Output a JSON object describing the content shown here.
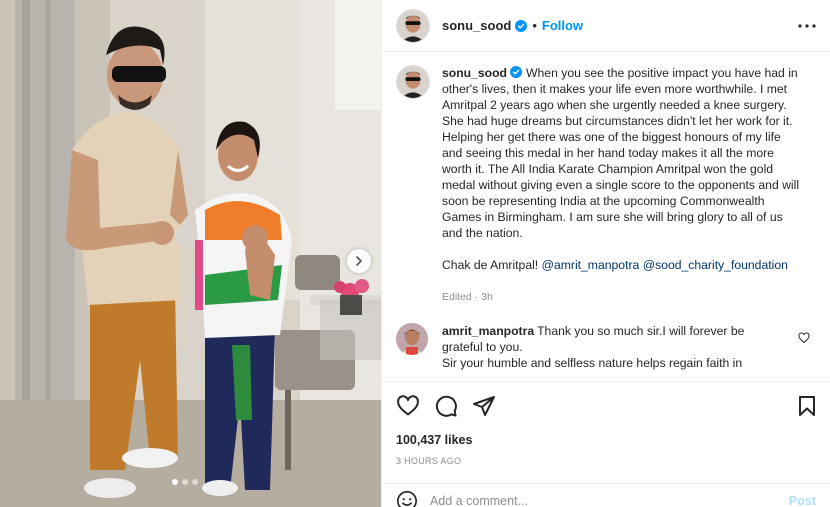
{
  "post": {
    "username": "sonu_sood",
    "follow_label": "Follow",
    "bullet": "•",
    "caption": "When you see the positive impact you have had in other's lives, then it makes your life even more worthwhile. I met Amritpal 2 years ago when she urgently needed a knee surgery. She had huge dreams but circumstances didn't let her work for it. Helping her get there was one of the biggest honours of my life and seeing this medal in her hand today makes it all the more worth it. The All India Karate Champion Amritpal won the gold medal without giving even a single score to the opponents and will soon be representing India at the upcoming Commonwealth Games in Birmingham. I am sure she will bring glory to all of us and the nation.",
    "caption_line2_prefix": "Chak de Amritpal! ",
    "mention_1": "@amrit_manpotra",
    "mention_2": "@sood_charity_foundation",
    "edited": "Edited · 3h",
    "likes": "100,437 likes",
    "time": "3 HOURS AGO"
  },
  "comment": {
    "username": "amrit_manpotra",
    "text": "Thank you so much sir.I will forever be grateful to you.",
    "text2": "Sir your humble and selfless nature helps regain faith in"
  },
  "add_comment": {
    "placeholder": "Add a comment...",
    "post_label": "Post"
  },
  "colors": {
    "accent": "#0095f6",
    "verified": "#0095f6",
    "muted": "#8e8e8e",
    "mention": "#00376b"
  },
  "icons": {
    "verified": "verified-badge-icon",
    "more": "more-horizontal-icon",
    "like": "heart-icon",
    "comment": "comment-icon",
    "share": "share-icon",
    "save": "bookmark-icon",
    "emoji": "emoji-icon",
    "next": "chevron-right-icon"
  },
  "carousel": {
    "slide_count": 3,
    "active_index": 0
  }
}
